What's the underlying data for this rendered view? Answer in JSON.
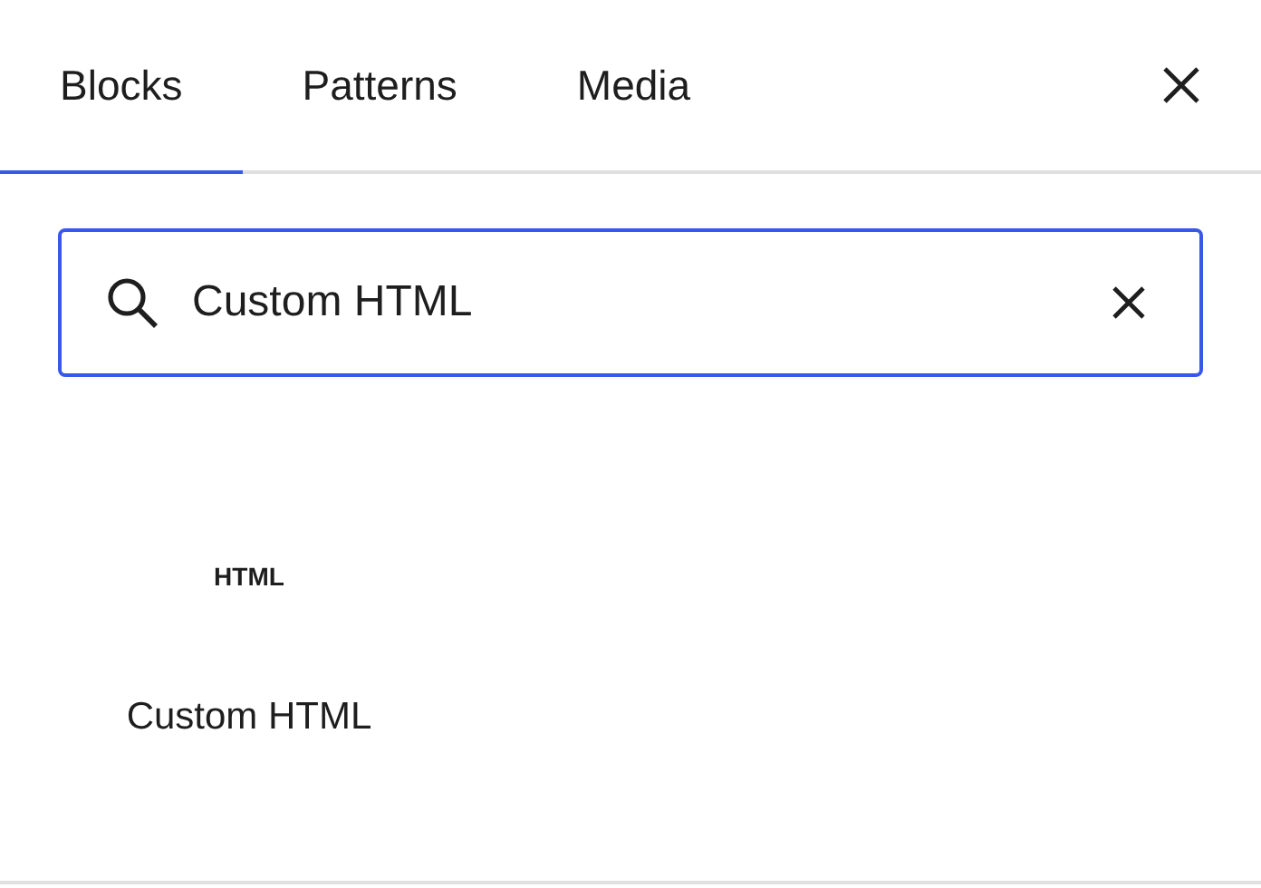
{
  "tabs": [
    {
      "label": "Blocks",
      "selected": true
    },
    {
      "label": "Patterns",
      "selected": false
    },
    {
      "label": "Media",
      "selected": false
    }
  ],
  "search": {
    "value": "Custom HTML"
  },
  "blocks": [
    {
      "icon_text": "HTML",
      "label": "Custom HTML"
    }
  ]
}
